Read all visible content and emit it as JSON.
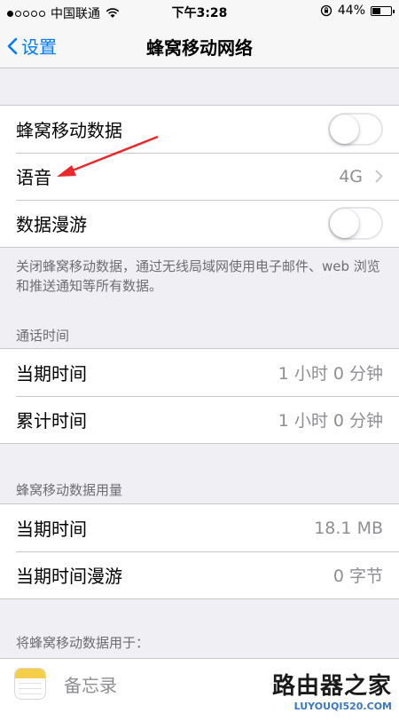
{
  "status_bar": {
    "carrier": "中国联通",
    "time": "下午3:28",
    "battery_percent": "44%",
    "battery_level": 0.44
  },
  "nav": {
    "back_label": "设置",
    "title": "蜂窝移动网络"
  },
  "cellular_group": {
    "cellular_data_label": "蜂窝移动数据",
    "cellular_data_on": false,
    "voice_label": "语音",
    "voice_value": "4G",
    "roaming_label": "数据漫游",
    "roaming_on": false
  },
  "cellular_note": "关闭蜂窝移动数据，通过无线局域网使用电子邮件、web 浏览和推送通知等所有数据。",
  "call_time": {
    "header": "通话时间",
    "rows": [
      {
        "label": "当期时间",
        "value": "1 小时 0 分钟"
      },
      {
        "label": "累计时间",
        "value": "1 小时 0 分钟"
      }
    ]
  },
  "data_usage": {
    "header": "蜂窝移动数据用量",
    "rows": [
      {
        "label": "当期时间",
        "value": "18.1 MB"
      },
      {
        "label": "当期时间漫游",
        "value": "0 字节"
      }
    ]
  },
  "use_for": {
    "header": "将蜂窝移动数据用于：",
    "apps": [
      {
        "label": "备忘录",
        "icon": "notes-icon"
      }
    ]
  },
  "watermark": {
    "main": "路由器之家",
    "sub": "LUYOUQI520.COM"
  },
  "colors": {
    "accent": "#007aff",
    "annotation": "#e8282b",
    "background": "#efeff4"
  }
}
